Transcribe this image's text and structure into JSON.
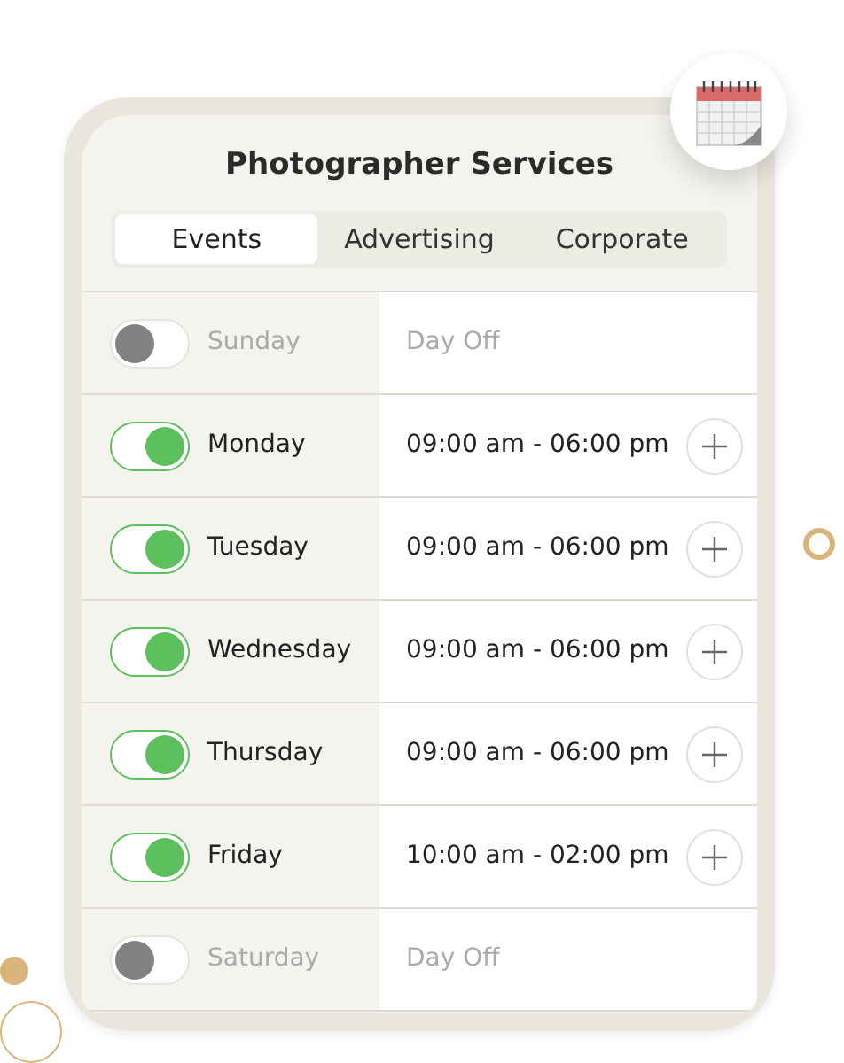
{
  "title": "Photographer Services",
  "tabs": [
    {
      "label": "Events",
      "selected": true
    },
    {
      "label": "Advertising",
      "selected": false
    },
    {
      "label": "Corporate",
      "selected": false
    }
  ],
  "days": [
    {
      "day": "Sunday",
      "on": false,
      "hours": "Day Off"
    },
    {
      "day": "Monday",
      "on": true,
      "hours": "09:00 am - 06:00 pm"
    },
    {
      "day": "Tuesday",
      "on": true,
      "hours": "09:00 am - 06:00 pm"
    },
    {
      "day": "Wednesday",
      "on": true,
      "hours": "09:00 am - 06:00 pm"
    },
    {
      "day": "Thursday",
      "on": true,
      "hours": "09:00 am - 06:00 pm"
    },
    {
      "day": "Friday",
      "on": true,
      "hours": "10:00 am - 02:00 pm"
    },
    {
      "day": "Saturday",
      "on": false,
      "hours": "Day Off"
    }
  ]
}
